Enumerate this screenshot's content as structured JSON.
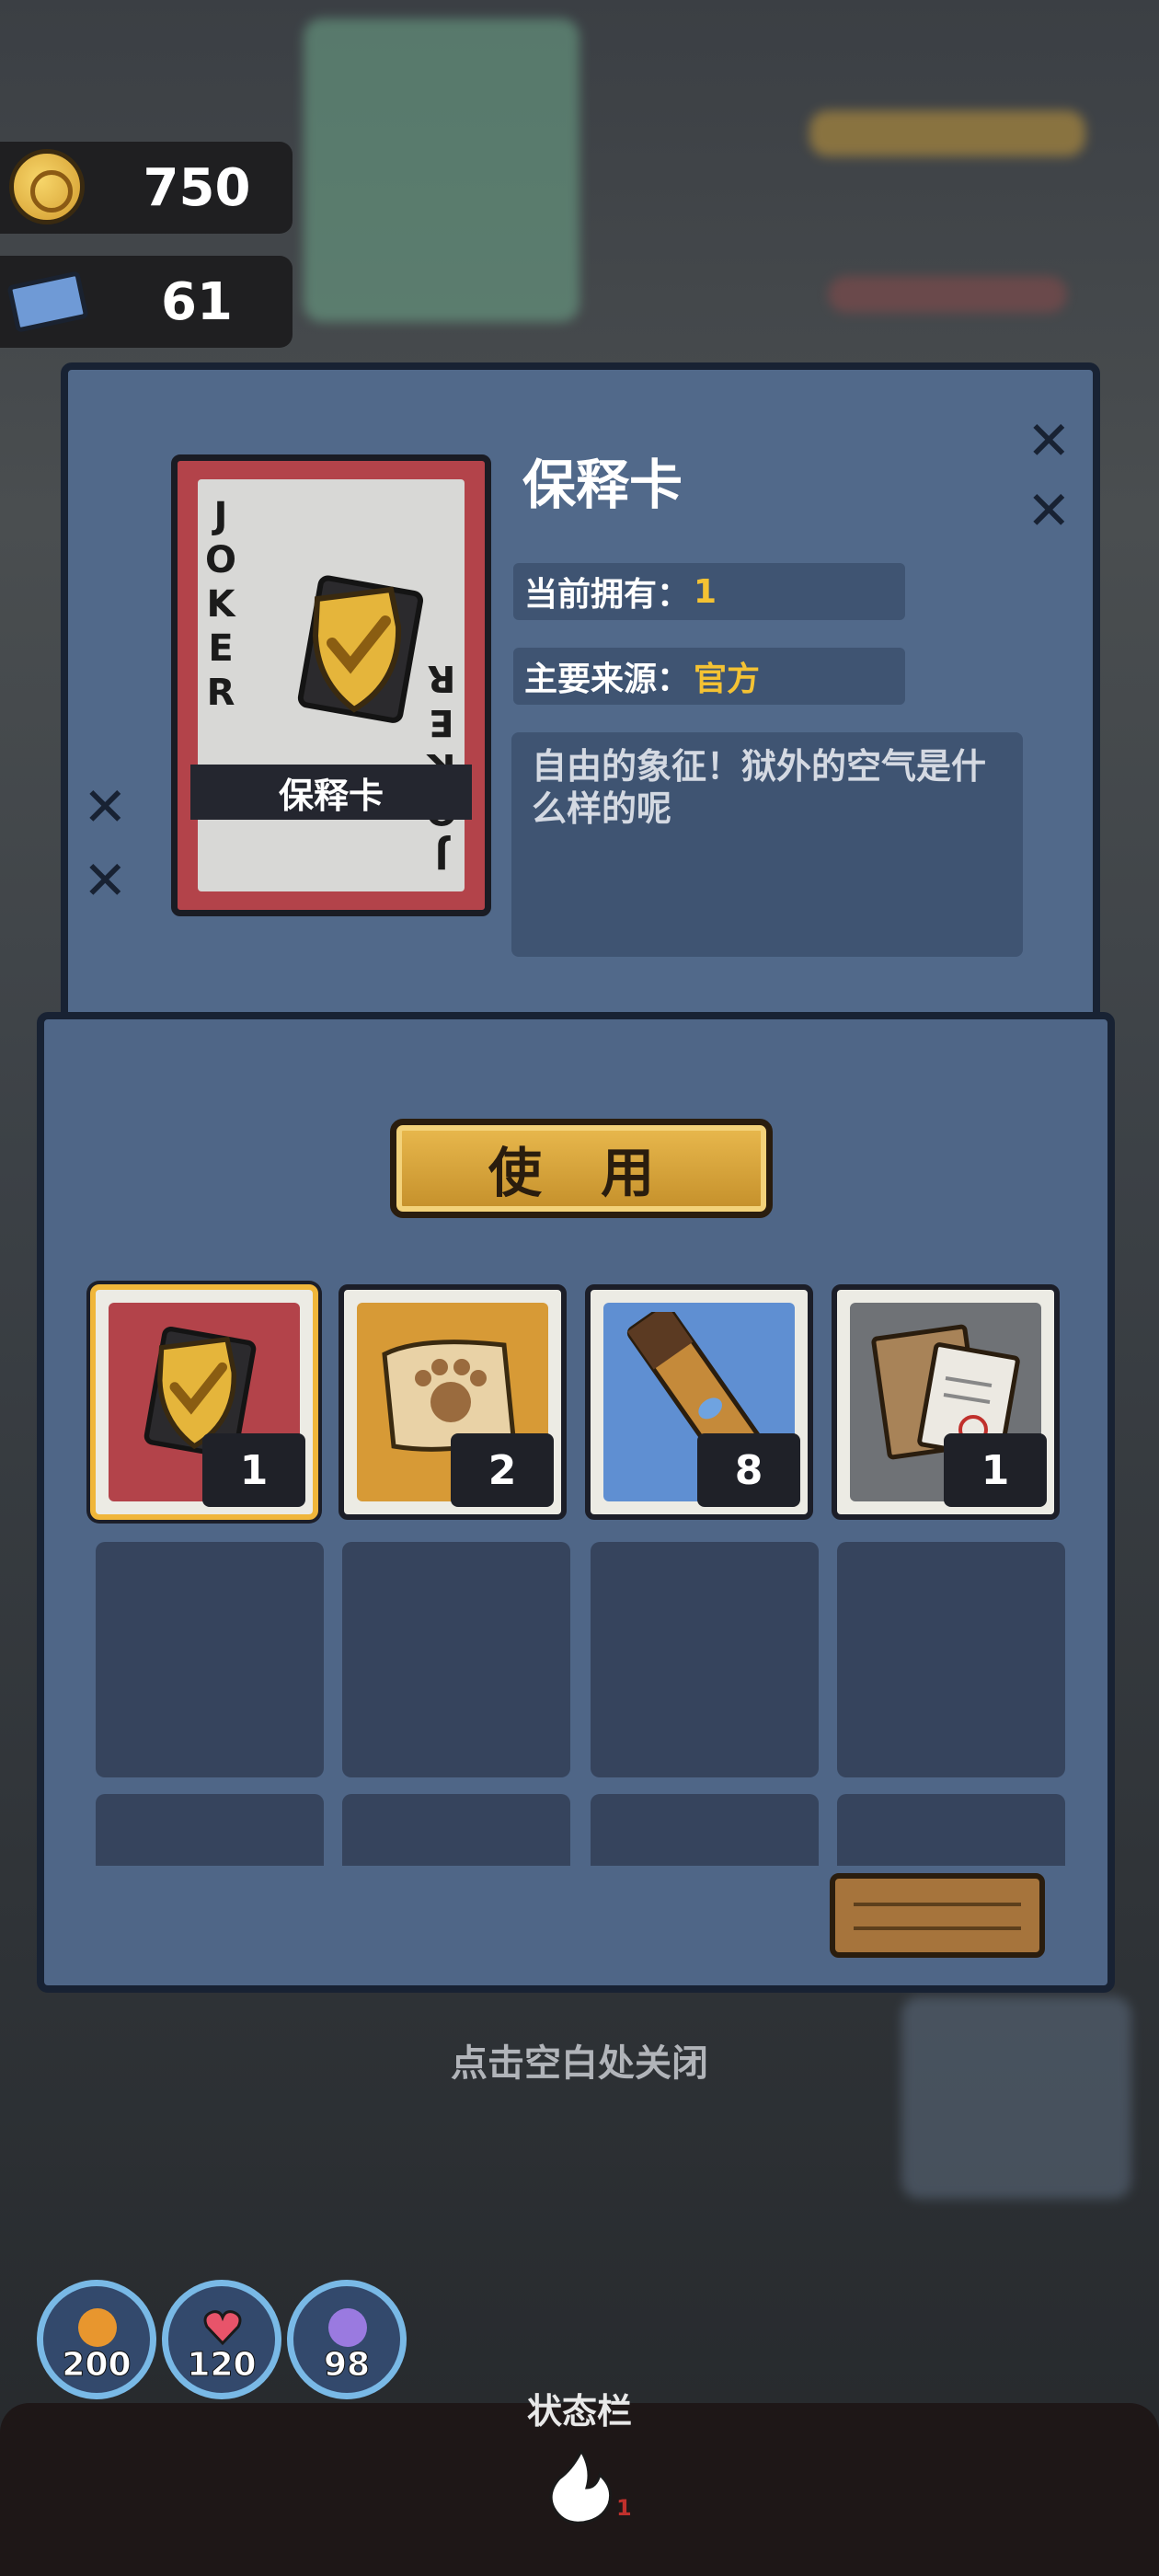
{
  "currency": {
    "coins": "750",
    "tickets": "61"
  },
  "item": {
    "title": "保释卡",
    "card_name": "保释卡",
    "joker_text": "JOKER",
    "owned_label": "当前拥有：",
    "owned_value": "1",
    "source_label": "主要来源：",
    "source_value": "官方",
    "description": "自由的象征！狱外的空气是什么样的呢"
  },
  "use_button": "使 用",
  "inventory": [
    {
      "name": "bail-card",
      "count": "1",
      "color": "#b3434a",
      "selected": true
    },
    {
      "name": "paw-map-scroll",
      "count": "2",
      "color": "#d79a36",
      "selected": false
    },
    {
      "name": "food-bar",
      "count": "8",
      "color": "#5f8fd2",
      "selected": false
    },
    {
      "name": "document-envelope",
      "count": "1",
      "color": "#6f7276",
      "selected": false
    }
  ],
  "close_hint": "点击空白处关闭",
  "stats": {
    "hunger": "200",
    "health": "120",
    "mind": "98"
  },
  "status_bar_label": "状态栏",
  "status_badge": "1",
  "colors": {
    "panel": "#51698a",
    "accent": "#f4c233",
    "stat_ring": "#79b9e6"
  }
}
